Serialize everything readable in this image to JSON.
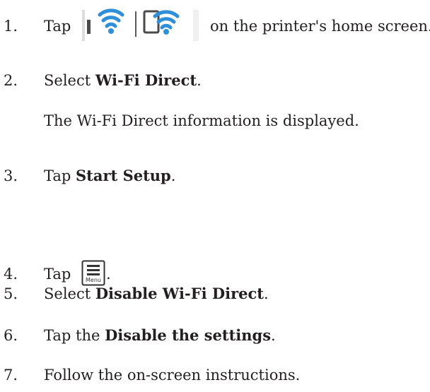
{
  "steps": [
    {
      "number": "1.",
      "before": "Tap",
      "icon": "wifi-direct-status-icon",
      "after": "on the printer's home screen."
    },
    {
      "number": "2.",
      "before": "Select ",
      "bold": "Wi-Fi Direct",
      "after": "."
    },
    {
      "note": "The Wi-Fi Direct information is displayed."
    },
    {
      "number": "3.",
      "before": "Tap ",
      "bold": "Start Setup",
      "after": "."
    },
    {
      "number": "4.",
      "before": "Tap",
      "icon": "menu-icon",
      "icon_label": "Menu",
      "after": "."
    },
    {
      "number": "5.",
      "before": "Select ",
      "bold": "Disable Wi-Fi Direct",
      "after": "."
    },
    {
      "number": "6.",
      "before": "Tap the ",
      "bold": "Disable the settings",
      "after": "."
    },
    {
      "number": "7.",
      "text": "Follow the on-screen instructions."
    }
  ],
  "colors": {
    "wifi_blue": "#2f8fd8",
    "icon_gray": "#4a4a4a",
    "text": "#231f20"
  }
}
